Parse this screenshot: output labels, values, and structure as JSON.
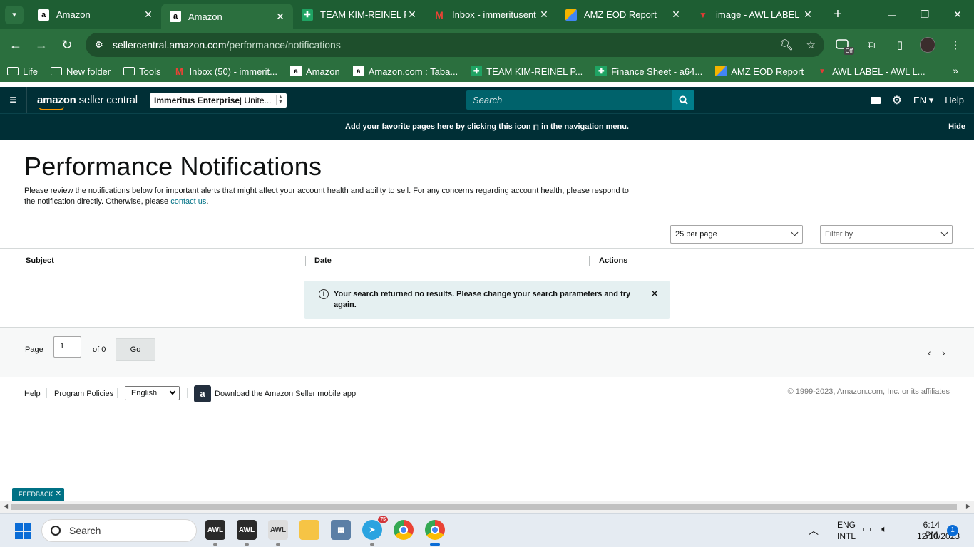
{
  "browser": {
    "tabs": [
      {
        "title": "Amazon",
        "icon": "amazon-icon",
        "active": false
      },
      {
        "title": "Amazon",
        "icon": "amazon-icon",
        "active": true
      },
      {
        "title": "TEAM KIM-REINEL PR",
        "icon": "sheets-icon",
        "active": false
      },
      {
        "title": "Inbox - immeritusent",
        "icon": "gmail-icon",
        "active": false
      },
      {
        "title": "AMZ EOD Report",
        "icon": "report-icon",
        "active": false
      },
      {
        "title": "image - AWL LABEL",
        "icon": "awl-icon",
        "active": false
      }
    ],
    "url_host": "sellercentral.amazon.com",
    "url_path": "/performance/notifications",
    "extension_badge": "Off",
    "bookmarks": [
      {
        "label": "Life",
        "icon": "folder-icon"
      },
      {
        "label": "New folder",
        "icon": "folder-icon"
      },
      {
        "label": "Tools",
        "icon": "folder-icon"
      },
      {
        "label": "Inbox (50) - immerit...",
        "icon": "gmail-icon"
      },
      {
        "label": "Amazon",
        "icon": "amazon-icon"
      },
      {
        "label": "Amazon.com : Taba...",
        "icon": "amazon-icon"
      },
      {
        "label": "TEAM KIM-REINEL P...",
        "icon": "sheets-icon"
      },
      {
        "label": "Finance Sheet - a64...",
        "icon": "sheets-icon"
      },
      {
        "label": "AMZ EOD Report",
        "icon": "report-icon"
      },
      {
        "label": "AWL LABEL - AWL L...",
        "icon": "awl-icon"
      }
    ]
  },
  "header": {
    "logo_bold": "amazon",
    "logo_rest": " seller central",
    "account_bold": "Immeritus Enterprise",
    "account_rest": " | Unite...",
    "search_placeholder": "Search",
    "language": "EN",
    "help": "Help",
    "favbar_text": "Add your favorite pages here by clicking this icon",
    "favbar_text2": "in the navigation menu.",
    "favbar_hide": "Hide"
  },
  "main": {
    "title": "Performance Notifications",
    "description": "Please review the notifications below for important alerts that might affect your account health and ability to sell. For any concerns regarding account health, please respond to the notification directly. Otherwise, please",
    "contact_link": "contact us",
    "per_page": "25 per page",
    "filter_placeholder": "Filter by",
    "columns": [
      "Subject",
      "Date",
      "Actions"
    ],
    "alert": "Your search returned no results. Please change your search parameters and try again.",
    "pager": {
      "page_label": "Page",
      "page_value": "1",
      "of_label": "of 0",
      "go": "Go"
    }
  },
  "footer": {
    "help": "Help",
    "program_policies": "Program Policies",
    "language": "English",
    "app_text": "Download the Amazon Seller mobile app",
    "copyright": "© 1999-2023, Amazon.com, Inc. or its affiliates"
  },
  "feedback": "FEEDBACK",
  "taskbar": {
    "search": "Search",
    "telegram_badge": "75",
    "lang1": "ENG",
    "lang2": "INTL",
    "time": "6:14 PM",
    "date": "12/18/2023",
    "notif_count": "1"
  },
  "colors": {
    "chrome_green": "#2b6f3e",
    "sc_header": "#002f36",
    "search_btn": "#007e8c",
    "link": "#007185",
    "alert_bg": "#e5f0f1"
  }
}
